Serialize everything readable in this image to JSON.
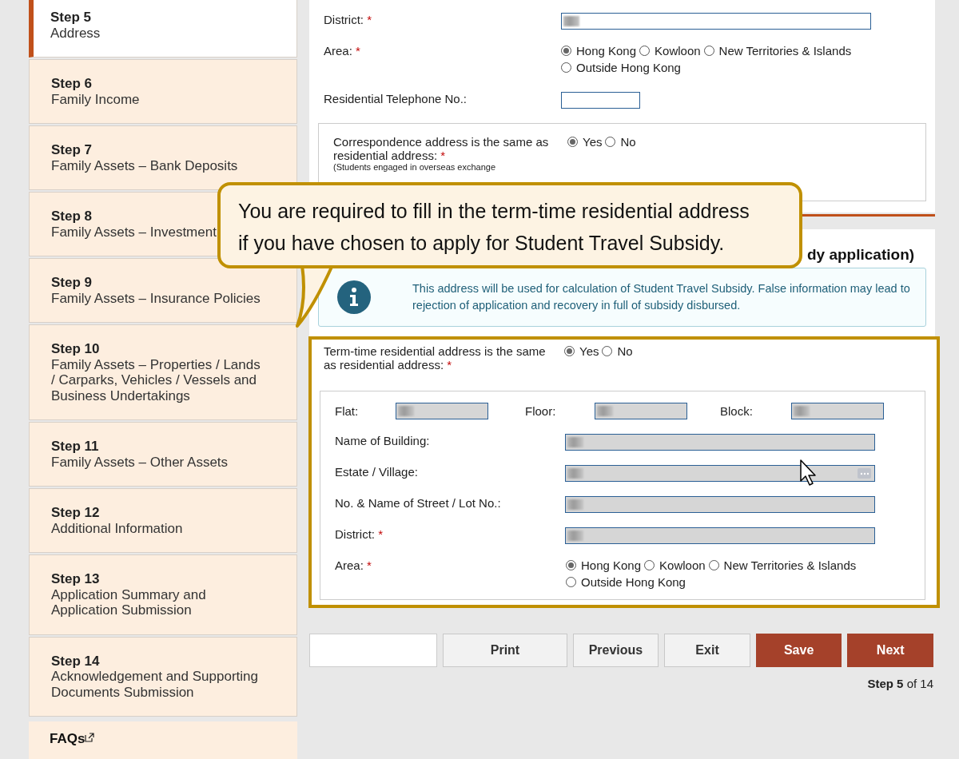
{
  "sidebar": {
    "items": [
      {
        "step": "Step 5",
        "title": "Address",
        "selected": true
      },
      {
        "step": "Step 6",
        "title": "Family Income",
        "selected": false
      },
      {
        "step": "Step 7",
        "title": "Family Assets – Bank Deposits",
        "selected": false
      },
      {
        "step": "Step 8",
        "title": "Family Assets – Investment",
        "selected": false
      },
      {
        "step": "Step 9",
        "title": "Family Assets – Insurance Policies",
        "selected": false
      },
      {
        "step": "Step 10",
        "title": "Family Assets – Properties / Lands / Carparks, Vehicles / Vessels and Business Undertakings",
        "selected": false
      },
      {
        "step": "Step 11",
        "title": "Family Assets – Other Assets",
        "selected": false
      },
      {
        "step": "Step 12",
        "title": "Additional Information",
        "selected": false
      },
      {
        "step": "Step 13",
        "title": "Application Summary and Application Submission",
        "selected": false
      },
      {
        "step": "Step 14",
        "title": "Acknowledgement and Supporting Documents Submission",
        "selected": false
      }
    ],
    "faqs": "FAQs"
  },
  "residential": {
    "rows": [
      {
        "kind": "field",
        "label": "District:",
        "mark": "*",
        "filled": true,
        "disabled": false
      },
      {
        "kind": "radios",
        "label": "Area:",
        "mark": "*",
        "options": [
          {
            "label": "Hong Kong",
            "selected": true
          },
          {
            "label": "Kowloon",
            "selected": false
          },
          {
            "label": "New Territories & Islands",
            "selected": false
          },
          {
            "label": "Outside Hong Kong",
            "selected": false
          }
        ]
      },
      {
        "kind": "short_field",
        "label": "Residential Telephone No.:",
        "filled": false,
        "disabled": false
      }
    ]
  },
  "correspondence": {
    "label": "Correspondence address is the same as residential address:",
    "mark": "*",
    "note": "(Students engaged in overseas exchange",
    "options": [
      {
        "label": "Yes",
        "selected": true
      },
      {
        "label": "No",
        "selected": false
      }
    ]
  },
  "section_heading": "dy application)",
  "info": {
    "text": "This address will be used for calculation of Student Travel Subsidy. False information may lead to rejection of application and recovery in full of subsidy disbursed."
  },
  "term_time": {
    "label": "Term-time residential address is the same as residential address:",
    "mark": "*",
    "options": [
      {
        "label": "Yes",
        "selected": true
      },
      {
        "label": "No",
        "selected": false
      }
    ],
    "rows": [
      {
        "kind": "triple",
        "fields": [
          {
            "label": "Flat:",
            "filled": true,
            "disabled": true
          },
          {
            "label": "Floor:",
            "filled": true,
            "disabled": true
          },
          {
            "label": "Block:",
            "filled": true,
            "disabled": true
          }
        ]
      },
      {
        "kind": "field",
        "label": "Name of Building:",
        "filled": true,
        "disabled": true
      },
      {
        "kind": "field",
        "label": "Estate / Village:",
        "filled": true,
        "disabled": true,
        "picker": true
      },
      {
        "kind": "field",
        "label": "No. & Name of Street / Lot No.:",
        "filled": true,
        "disabled": true
      },
      {
        "kind": "field",
        "label": "District:",
        "mark": "*",
        "filled": true,
        "disabled": true
      },
      {
        "kind": "radios",
        "label": "Area:",
        "mark": "*",
        "options": [
          {
            "label": "Hong Kong",
            "selected": true
          },
          {
            "label": "Kowloon",
            "selected": false
          },
          {
            "label": "New Territories & Islands",
            "selected": false
          },
          {
            "label": "Outside Hong Kong",
            "selected": false
          }
        ]
      }
    ]
  },
  "buttons": [
    {
      "label": "Print",
      "kind": "plain"
    },
    {
      "label": "Previous",
      "kind": "plain"
    },
    {
      "label": "Exit",
      "kind": "plain"
    },
    {
      "label": "Save",
      "kind": "primary"
    },
    {
      "label": "Next",
      "kind": "primary"
    }
  ],
  "step_indicator": {
    "current": "Step 5",
    "total": "of 14"
  },
  "callout": {
    "text": "You are required to fill in the term-time residential address if you have chosen to apply for Student Travel Subsidy."
  }
}
